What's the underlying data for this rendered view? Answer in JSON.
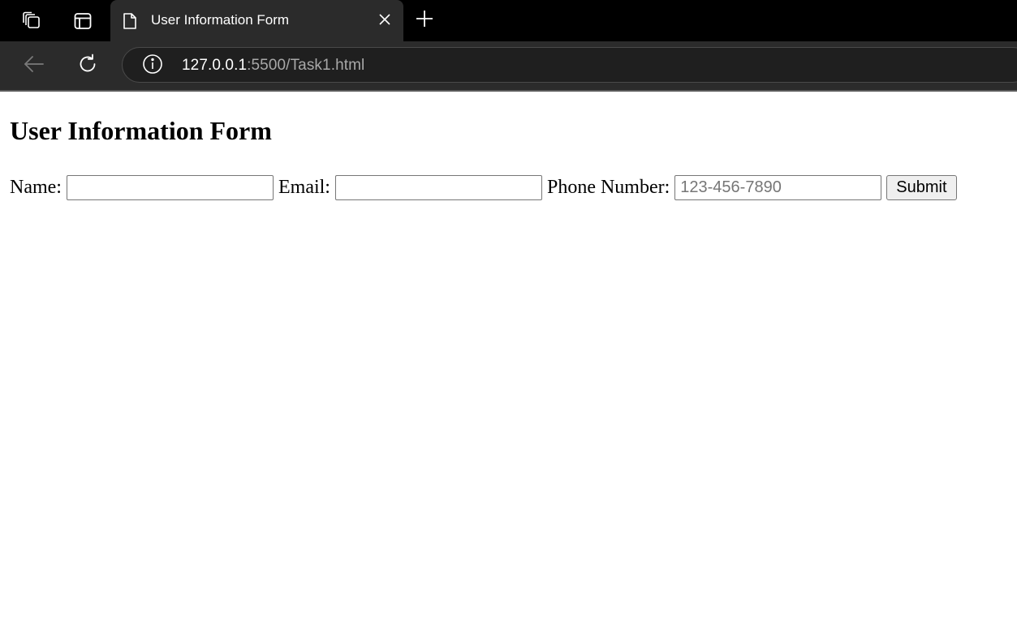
{
  "browser": {
    "tab": {
      "title": "User Information Form",
      "favicon": "page-icon"
    },
    "address_bar": {
      "url_host": "127.0.0.1",
      "url_rest": ":5500/Task1.html"
    },
    "icons": {
      "workspaces": "workspaces-icon",
      "tab_actions": "tab-actions-icon",
      "close_tab": "close-icon",
      "new_tab": "plus-icon",
      "back": "back-arrow-icon",
      "refresh": "refresh-icon",
      "site_info": "info-icon"
    }
  },
  "page": {
    "heading": "User Information Form",
    "form": {
      "name_label": "Name:",
      "name_value": "",
      "email_label": "Email:",
      "email_value": "",
      "phone_label": "Phone Number:",
      "phone_value": "",
      "phone_placeholder": "123-456-7890",
      "submit_label": "Submit"
    }
  },
  "colors": {
    "chrome_dark": "#000000",
    "toolbar": "#2b2b2b",
    "page_bg": "#ffffff"
  }
}
